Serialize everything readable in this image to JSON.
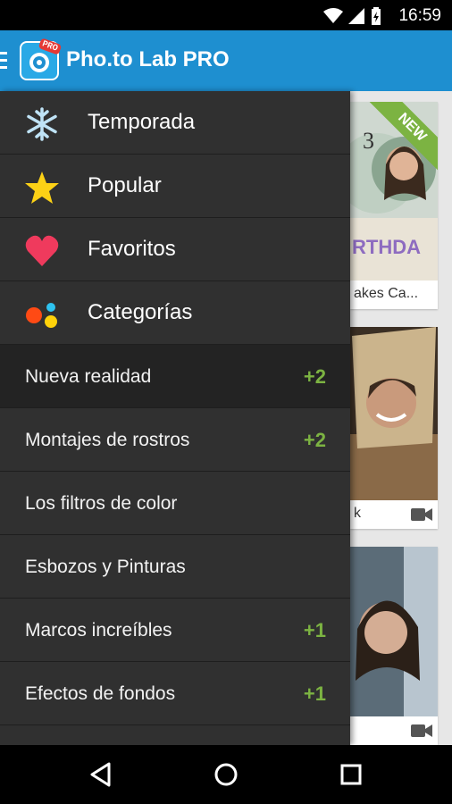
{
  "status": {
    "time": "16:59"
  },
  "appbar": {
    "title": "Pho.to Lab PRO",
    "logo_badge": "PRO"
  },
  "drawer": {
    "main_items": [
      {
        "label": "Temporada",
        "icon": "snowflake-icon"
      },
      {
        "label": "Popular",
        "icon": "star-icon"
      },
      {
        "label": "Favoritos",
        "icon": "heart-icon"
      },
      {
        "label": "Categorías",
        "icon": "categories-icon"
      }
    ],
    "categories": [
      {
        "label": "Nueva realidad",
        "badge": "+2",
        "active": true
      },
      {
        "label": "Montajes de rostros",
        "badge": "+2"
      },
      {
        "label": "Los filtros de color",
        "badge": ""
      },
      {
        "label": "Esbozos y Pinturas",
        "badge": ""
      },
      {
        "label": "Marcos increíbles",
        "badge": "+1"
      },
      {
        "label": "Efectos de fondos",
        "badge": "+1"
      }
    ]
  },
  "content": {
    "cards": [
      {
        "label": "akes Ca...",
        "new_badge": "NEW",
        "number": "3",
        "birthday_text": "RTHDA"
      },
      {
        "label": "k"
      },
      {
        "label": ""
      }
    ]
  },
  "colors": {
    "appbar": "#1e8fd0",
    "drawer": "#303030",
    "badge": "#7cb342"
  }
}
